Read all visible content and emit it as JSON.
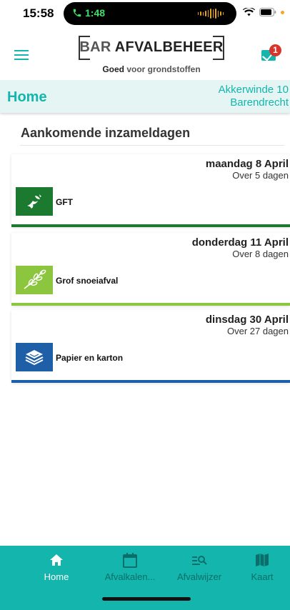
{
  "status_bar": {
    "time": "15:58",
    "call_duration": "1:48"
  },
  "header": {
    "logo_prefix": "BAR",
    "logo_name": "AFVALBEHEER",
    "tagline_bold": "Goed",
    "tagline_rest": "voor grondstoffen",
    "mail_badge_count": "1",
    "accent_color": "#14b5ad"
  },
  "titlebar": {
    "title": "Home",
    "address_line1": "Akkerwinde 10",
    "address_line2": "Barendrecht"
  },
  "section": {
    "heading": "Aankomende inzameldagen"
  },
  "pickups": [
    {
      "date": "maandag 8 April",
      "due": "Over 5 dagen",
      "label": "GFT",
      "icon": "leaf-bin-icon",
      "color": "#1b7a2f"
    },
    {
      "date": "donderdag 11 April",
      "due": "Over 8 dagen",
      "label": "Grof snoeiafval",
      "icon": "branch-icon",
      "color": "#8cc63f"
    },
    {
      "date": "dinsdag 30 April",
      "due": "Over 27 dagen",
      "label": "Papier en karton",
      "icon": "paper-stack-icon",
      "color": "#1e5fa8"
    }
  ],
  "nav": [
    {
      "label": "Home",
      "icon": "home-icon",
      "active": true
    },
    {
      "label": "Afvalkalen...",
      "icon": "calendar-icon",
      "active": false
    },
    {
      "label": "Afvalwijzer",
      "icon": "search-list-icon",
      "active": false
    },
    {
      "label": "Kaart",
      "icon": "map-icon",
      "active": false
    }
  ]
}
